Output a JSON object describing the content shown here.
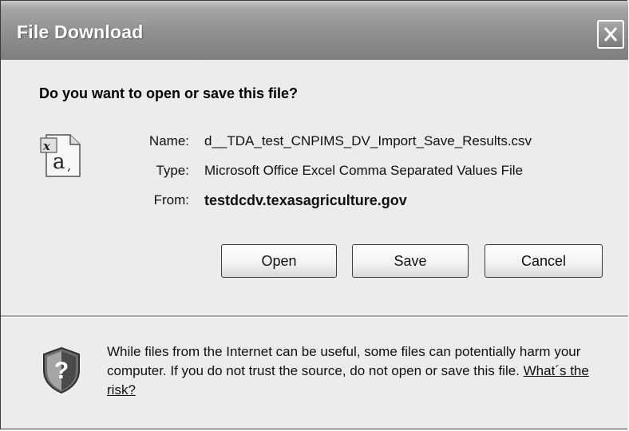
{
  "window": {
    "title": "File Download",
    "close_icon": "close-icon"
  },
  "dialog": {
    "question": "Do you want to open or save this file?",
    "file_icon": "csv-file-icon",
    "fields": [
      {
        "label": "Name:",
        "value": "d__TDA_test_CNPIMS_DV_Import_Save_Results.csv"
      },
      {
        "label": "Type:",
        "value": "Microsoft Office Excel Comma Separated Values File"
      },
      {
        "label": "From:",
        "value": "testdcdv.texasagriculture.gov"
      }
    ],
    "buttons": {
      "open": "Open",
      "save": "Save",
      "cancel": "Cancel"
    }
  },
  "warning": {
    "icon": "security-shield-icon",
    "text": "While files from the Internet can be useful, some files can potentially harm your computer. If you do not trust the source, do not open or save this file. ",
    "link": "What´s the risk?"
  }
}
